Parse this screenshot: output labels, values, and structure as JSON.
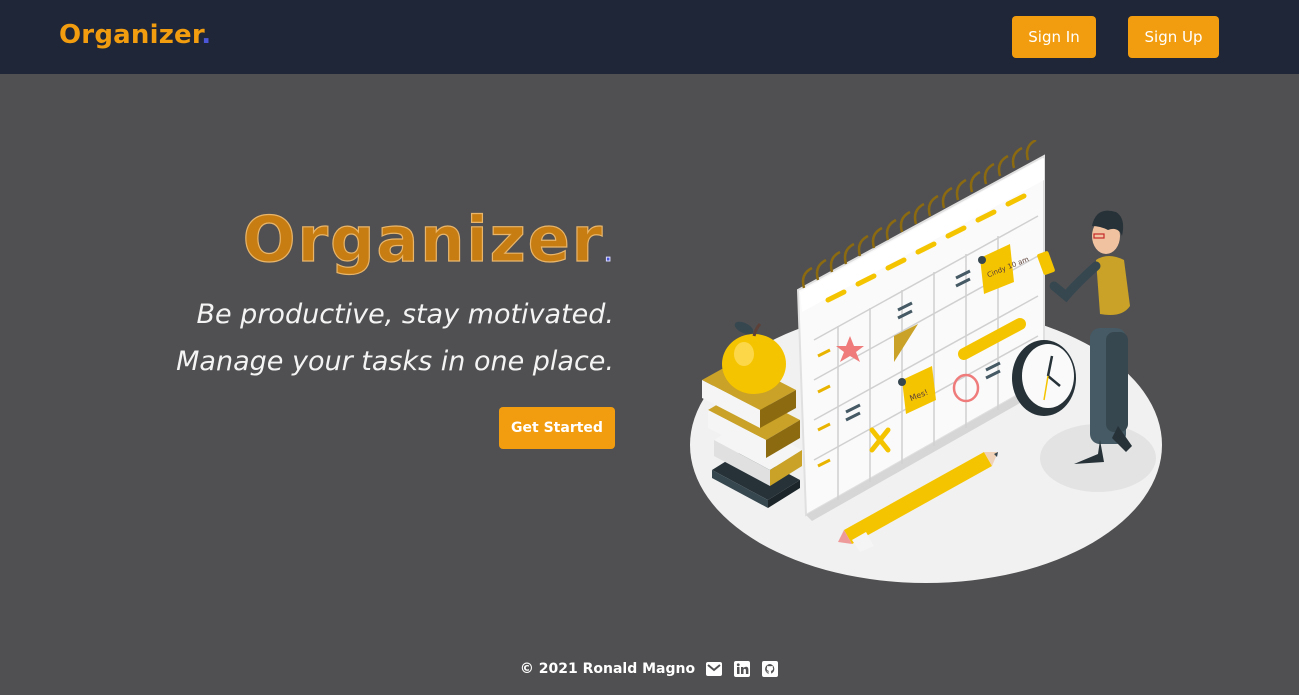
{
  "nav": {
    "brand": "Organizer",
    "brand_dot": ".",
    "signin_label": "Sign In",
    "signup_label": "Sign Up"
  },
  "hero": {
    "title": "Organizer",
    "title_dot": ".",
    "tagline_1": "Be productive, stay motivated.",
    "tagline_2": "Manage your tasks in one place.",
    "cta_label": "Get Started"
  },
  "illustration": {
    "note_1": "Cindy 10 am",
    "note_2": "Mes!"
  },
  "footer": {
    "copyright": "© 2021 Ronald Magno",
    "icons": [
      "email-icon",
      "linkedin-icon",
      "github-icon"
    ]
  },
  "colors": {
    "accent": "#f29d0f",
    "navbar": "#1f2637",
    "background": "#505052",
    "brand_dot": "#4b57d8"
  }
}
